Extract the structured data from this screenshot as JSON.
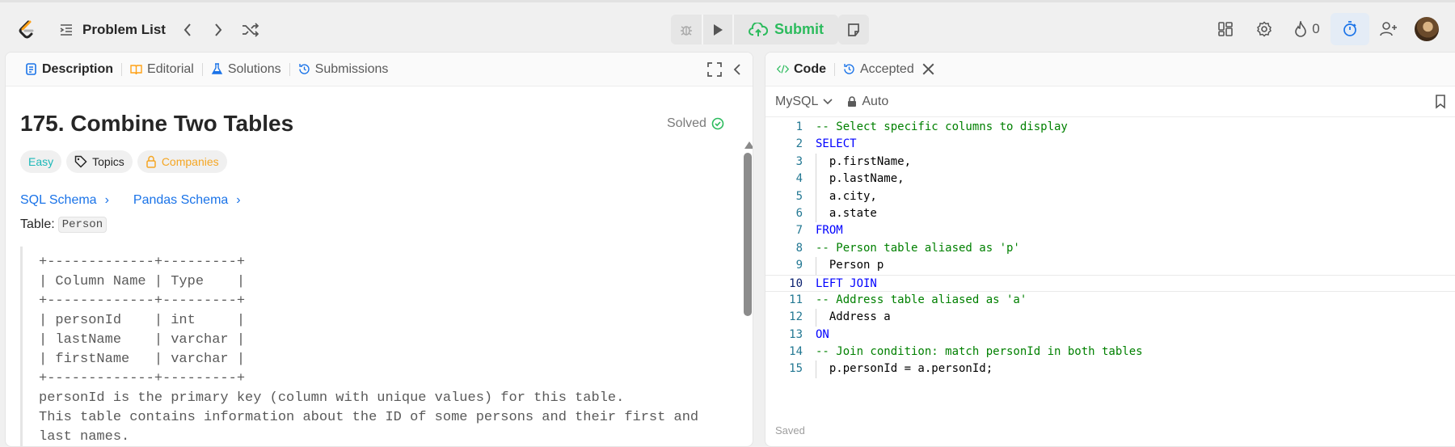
{
  "header": {
    "problem_list_label": "Problem List",
    "submit_label": "Submit",
    "streak_count": "0"
  },
  "left_panel": {
    "tabs": [
      {
        "label": "Description"
      },
      {
        "label": "Editorial"
      },
      {
        "label": "Solutions"
      },
      {
        "label": "Submissions"
      }
    ],
    "title": "175. Combine Two Tables",
    "solved_label": "Solved",
    "badges": {
      "difficulty": "Easy",
      "topics": "Topics",
      "companies": "Companies"
    },
    "links": [
      "SQL Schema",
      "Pandas Schema"
    ],
    "table_label": "Table:",
    "table_name": "Person",
    "schema_block": "+-------------+---------+\n| Column Name | Type    |\n+-------------+---------+\n| personId    | int     |\n| lastName    | varchar |\n| firstName   | varchar |\n+-------------+---------+\npersonId is the primary key (column with unique values) for this table.\nThis table contains information about the ID of some persons and their first and\nlast names."
  },
  "right_panel": {
    "tabs": [
      {
        "label": "Code"
      },
      {
        "label": "Accepted"
      }
    ],
    "language": "MySQL",
    "mode": "Auto",
    "saved_label": "Saved",
    "code_lines": [
      {
        "n": "1",
        "text": "-- Select specific columns to display",
        "kind": "comment"
      },
      {
        "n": "2",
        "text": "SELECT",
        "kind": "kw"
      },
      {
        "n": "3",
        "text": "  p.firstName,",
        "kind": "plain"
      },
      {
        "n": "4",
        "text": "  p.lastName,",
        "kind": "plain"
      },
      {
        "n": "5",
        "text": "  a.city,",
        "kind": "plain"
      },
      {
        "n": "6",
        "text": "  a.state",
        "kind": "plain"
      },
      {
        "n": "7",
        "text": "FROM",
        "kind": "kw"
      },
      {
        "n": "8",
        "text": "-- Person table aliased as 'p'",
        "kind": "comment"
      },
      {
        "n": "9",
        "text": "  Person p",
        "kind": "plain"
      },
      {
        "n": "10",
        "text": "LEFT JOIN",
        "kind": "kw"
      },
      {
        "n": "11",
        "text": "-- Address table aliased as 'a'",
        "kind": "comment"
      },
      {
        "n": "12",
        "text": "  Address a",
        "kind": "plain"
      },
      {
        "n": "13",
        "text": "ON",
        "kind": "kw"
      },
      {
        "n": "14",
        "text": "-- Join condition: match personId in both tables",
        "kind": "comment"
      },
      {
        "n": "15",
        "text": "  p.personId = a.personId;",
        "kind": "plain"
      }
    ],
    "current_line": "10"
  }
}
